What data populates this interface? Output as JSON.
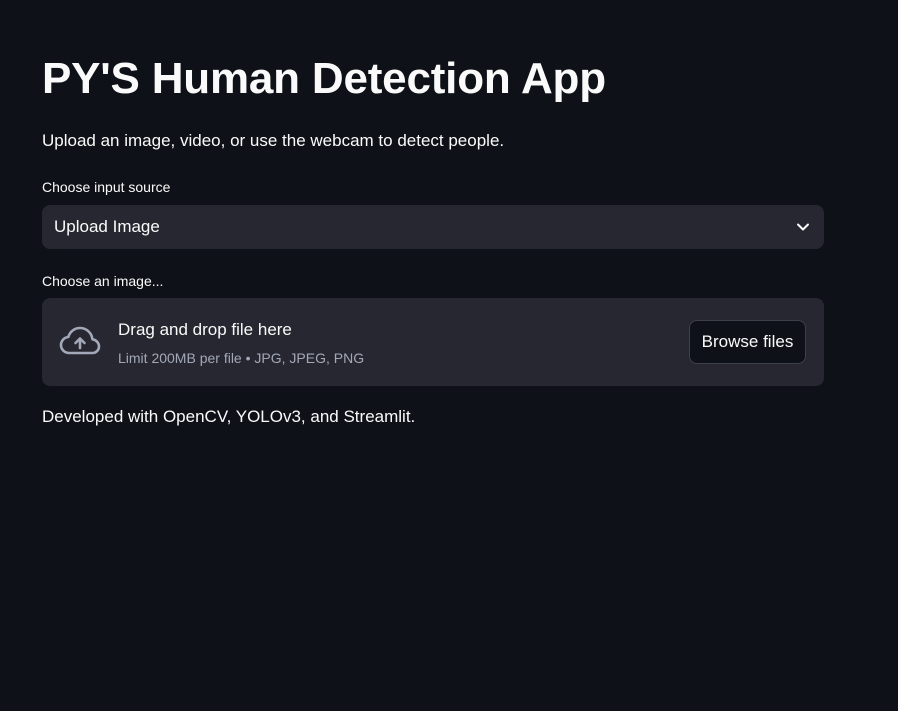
{
  "header": {
    "title": "PY'S Human Detection App",
    "subtitle": "Upload an image, video, or use the webcam to detect people."
  },
  "source_select": {
    "label": "Choose input source",
    "value": "Upload Image",
    "icon": "chevron-down-icon"
  },
  "uploader": {
    "label": "Choose an image...",
    "drop_title": "Drag and drop file here",
    "limit_text": "Limit 200MB per file • JPG, JPEG, PNG",
    "browse_label": "Browse files",
    "icon": "cloud-upload-icon"
  },
  "footer": {
    "text": "Developed with OpenCV, YOLOv3, and Streamlit."
  },
  "colors": {
    "background": "#0e1117",
    "widget_background": "#262730",
    "text": "#fafafa",
    "muted_text": "#a3a8b8"
  }
}
